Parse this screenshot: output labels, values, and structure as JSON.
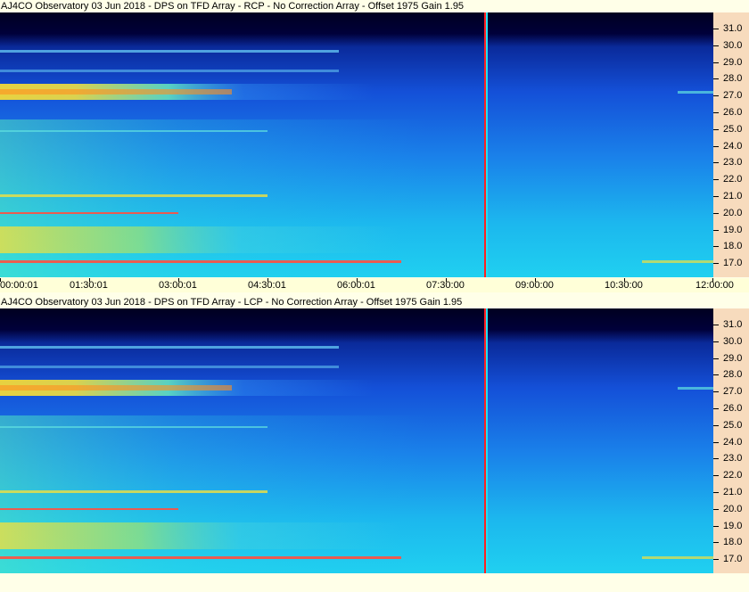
{
  "panels": [
    {
      "id": "rcp",
      "title": "AJ4CO Observatory 03 Jun 2018 - DPS on TFD Array   - RCP  -  No Correction Array  -  Offset 1975  Gain 1.95"
    },
    {
      "id": "lcp",
      "title": "AJ4CO Observatory 03 Jun 2018 - DPS on TFD Array  - LCP  -  No Correction Array  -  Offset 1975  Gain 1.95"
    }
  ],
  "time_axis": [
    "00:00:01",
    "01:30:01",
    "03:00:01",
    "04:30:01",
    "06:00:01",
    "07:30:00",
    "09:00:00",
    "10:30:00",
    "12:00:00"
  ],
  "freq_axis": [
    "31.0",
    "30.0",
    "29.0",
    "28.0",
    "27.0",
    "26.0",
    "25.0",
    "24.0",
    "23.0",
    "22.0",
    "21.0",
    "20.0",
    "19.0",
    "18.0",
    "17.0"
  ],
  "colors": {
    "background": "#ffffe8",
    "freq_axis_bg": "#f7dbbd",
    "time_axis_bg": "#ffffd8",
    "spectrogram_low": "#00005a",
    "spectrogram_mid": "#1a5ef0",
    "spectrogram_high": "#22d8e8",
    "hot": "#f0e020",
    "marker_red": "#ff2020",
    "marker_cyan": "#20e0f0"
  }
}
